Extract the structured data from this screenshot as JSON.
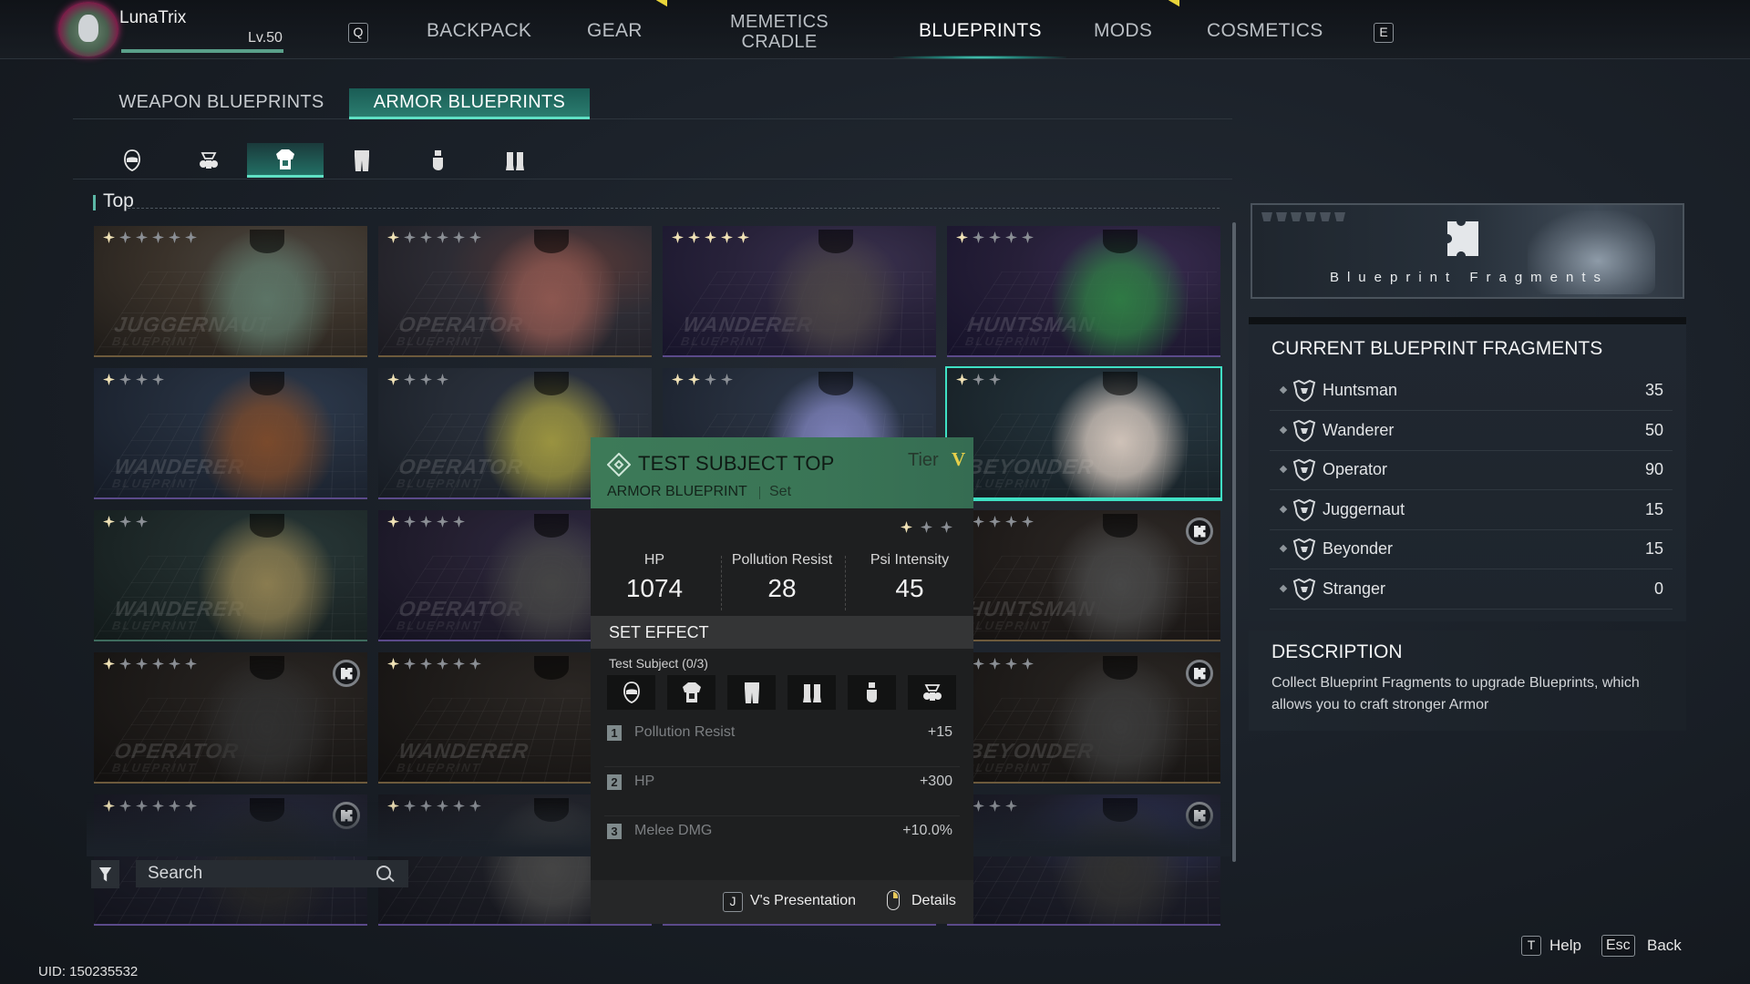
{
  "header": {
    "username": "LunaTrix",
    "level": "Lv.50",
    "level_progress": 1.0,
    "prev_key": "Q",
    "next_key": "E",
    "nav": [
      {
        "label": "BACKPACK",
        "active": false,
        "notification": true
      },
      {
        "label": "GEAR",
        "active": false
      },
      {
        "label": "MEMETICS CRADLE",
        "active": false
      },
      {
        "label": "BLUEPRINTS",
        "active": true
      },
      {
        "label": "MODS",
        "active": false,
        "notification": true
      },
      {
        "label": "COSMETICS",
        "active": false
      }
    ]
  },
  "subtabs": [
    {
      "label": "WEAPON BLUEPRINTS",
      "active": false
    },
    {
      "label": "ARMOR BLUEPRINTS",
      "active": true
    }
  ],
  "slots": [
    {
      "icon": "helmet-icon",
      "active": false
    },
    {
      "icon": "gas-mask-icon",
      "active": false
    },
    {
      "icon": "top-armor-icon",
      "active": true
    },
    {
      "icon": "pants-icon",
      "active": false
    },
    {
      "icon": "gloves-icon",
      "active": false
    },
    {
      "icon": "boots-icon",
      "active": false
    }
  ],
  "section_title": "Top",
  "cards": [
    {
      "brand": "JUGGERNAUT",
      "stars_lit": 1,
      "stars_total": 6,
      "owned": true,
      "fragment_badge": false
    },
    {
      "brand": "OPERATOR",
      "stars_lit": 1,
      "stars_total": 6,
      "owned": true,
      "fragment_badge": false
    },
    {
      "brand": "WANDERER",
      "stars_lit": 5,
      "stars_total": 5,
      "owned": true,
      "fragment_badge": false
    },
    {
      "brand": "HUNTSMAN",
      "stars_lit": 1,
      "stars_total": 5,
      "owned": true,
      "fragment_badge": false
    },
    {
      "brand": "WANDERER",
      "stars_lit": 1,
      "stars_total": 4,
      "owned": true,
      "fragment_badge": false
    },
    {
      "brand": "OPERATOR",
      "stars_lit": 1,
      "stars_total": 4,
      "owned": true,
      "fragment_badge": false
    },
    {
      "brand": "WANDERER",
      "stars_lit": 2,
      "stars_total": 4,
      "owned": true,
      "fragment_badge": false
    },
    {
      "brand": "BEYONDER",
      "stars_lit": 1,
      "stars_total": 3,
      "owned": true,
      "fragment_badge": false,
      "selected": true
    },
    {
      "brand": "WANDERER",
      "stars_lit": 1,
      "stars_total": 3,
      "owned": true,
      "fragment_badge": false
    },
    {
      "brand": "OPERATOR",
      "stars_lit": 1,
      "stars_total": 5,
      "owned": false,
      "fragment_badge": false
    },
    {
      "brand": "",
      "stars_lit": 0,
      "stars_total": 0,
      "owned": false,
      "fragment_badge": false
    },
    {
      "brand": "HUNTSMAN",
      "stars_lit": 0,
      "stars_total": 5,
      "owned": false,
      "fragment_badge": true
    },
    {
      "brand": "OPERATOR",
      "stars_lit": 1,
      "stars_total": 6,
      "owned": false,
      "fragment_badge": true
    },
    {
      "brand": "WANDERER",
      "stars_lit": 1,
      "stars_total": 6,
      "owned": false,
      "fragment_badge": false
    },
    {
      "brand": "",
      "stars_lit": 0,
      "stars_total": 0,
      "owned": false,
      "fragment_badge": false
    },
    {
      "brand": "BEYONDER",
      "stars_lit": 0,
      "stars_total": 5,
      "owned": false,
      "fragment_badge": true
    },
    {
      "brand": "",
      "stars_lit": 1,
      "stars_total": 6,
      "owned": false,
      "fragment_badge": true
    },
    {
      "brand": "",
      "stars_lit": 1,
      "stars_total": 6,
      "owned": false,
      "fragment_badge": false
    },
    {
      "brand": "",
      "stars_lit": 0,
      "stars_total": 0,
      "owned": false,
      "fragment_badge": false
    },
    {
      "brand": "",
      "stars_lit": 0,
      "stars_total": 4,
      "owned": false,
      "fragment_badge": true
    }
  ],
  "brand_subtitle": "BLUEPRINT",
  "tooltip": {
    "title": "TEST SUBJECT TOP",
    "tier_label": "Tier",
    "tier": "V",
    "type": "ARMOR BLUEPRINT",
    "set_tag": "Set",
    "stars_lit": 1,
    "stars_total": 3,
    "stats": [
      {
        "label": "HP",
        "value": "1074"
      },
      {
        "label": "Pollution Resist",
        "value": "28"
      },
      {
        "label": "Psi Intensity",
        "value": "45"
      }
    ],
    "set_effect_label": "SET EFFECT",
    "set_name": "Test Subject (0/3)",
    "set_pieces": [
      "helmet-icon",
      "top-armor-icon",
      "pants-icon",
      "boots-icon",
      "gloves-icon",
      "gas-mask-icon"
    ],
    "effects": [
      {
        "num": "1",
        "name": "Pollution Resist",
        "amount": "+15"
      },
      {
        "num": "2",
        "name": "HP",
        "amount": "+300"
      },
      {
        "num": "3",
        "name": "Melee DMG",
        "amount": "+10.0%"
      }
    ],
    "presentation_key": "J",
    "presentation_label": "V's Presentation",
    "details_label": "Details"
  },
  "search": {
    "placeholder": "Search"
  },
  "right_panel": {
    "banner_title": "Blueprint Fragments",
    "fragments_title": "CURRENT BLUEPRINT FRAGMENTS",
    "fragments": [
      {
        "name": "Huntsman",
        "count": "35"
      },
      {
        "name": "Wanderer",
        "count": "50"
      },
      {
        "name": "Operator",
        "count": "90"
      },
      {
        "name": "Juggernaut",
        "count": "15"
      },
      {
        "name": "Beyonder",
        "count": "15"
      },
      {
        "name": "Stranger",
        "count": "0"
      }
    ],
    "description_title": "DESCRIPTION",
    "description": "Collect Blueprint Fragments to upgrade Blueprints, which allows you to craft stronger Armor"
  },
  "footer": {
    "uid": "UID: 150235532",
    "help_key": "T",
    "help_label": "Help",
    "back_key": "Esc",
    "back_label": "Back"
  },
  "colors": {
    "accent": "#3fe0c4",
    "tooltip_header": "#3d7a58",
    "tier": "#e6cf4a",
    "star_lit": "#efe1b5"
  }
}
